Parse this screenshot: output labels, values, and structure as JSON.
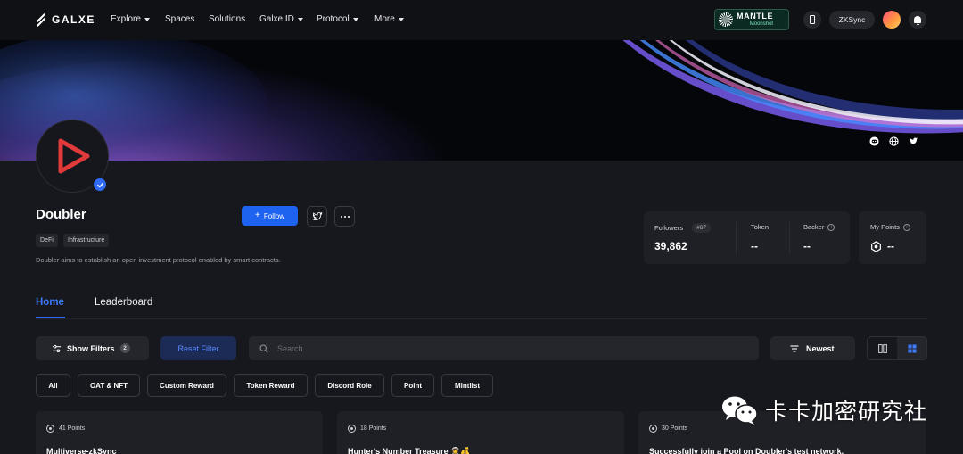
{
  "nav": {
    "logo_text": "GALXE",
    "items": [
      {
        "label": "Explore",
        "dropdown": true
      },
      {
        "label": "Spaces",
        "dropdown": false
      },
      {
        "label": "Solutions",
        "dropdown": false
      },
      {
        "label": "Galxe ID",
        "dropdown": true
      },
      {
        "label": "Protocol",
        "dropdown": true
      },
      {
        "label": "More",
        "dropdown": true
      }
    ],
    "promo_title": "MANTLE",
    "promo_subtitle": "Moonshot",
    "chain_label": "ZKSync"
  },
  "banner": {
    "links": [
      "discord-icon",
      "globe-icon",
      "twitter-icon"
    ]
  },
  "profile": {
    "name": "Doubler",
    "tags": [
      "DeFi",
      "Infrastructure"
    ],
    "description": "Doubler aims to establish an open investment protocol enabled by smart contracts.",
    "follow_label": "Follow",
    "verified": true
  },
  "stats": {
    "followers_label": "Followers",
    "followers_rank": "#67",
    "followers_value": "39,862",
    "token_label": "Token",
    "token_value": "--",
    "backer_label": "Backer",
    "backer_value": "--",
    "points_label": "My Points",
    "points_value": "--"
  },
  "tabs": [
    {
      "label": "Home",
      "active": true
    },
    {
      "label": "Leaderboard",
      "active": false
    }
  ],
  "filters": {
    "show_filters_label": "Show Filters",
    "filter_count": "2",
    "reset_label": "Reset Filter",
    "search_placeholder": "Search",
    "sort_label": "Newest",
    "view_mode": "grid"
  },
  "chips": [
    "All",
    "OAT & NFT",
    "Custom Reward",
    "Token Reward",
    "Discord Role",
    "Point",
    "Mintlist"
  ],
  "cards": [
    {
      "points": "41 Points",
      "title": "Multiverse-zkSync"
    },
    {
      "points": "18 Points",
      "title": "Hunter's Number Treasure 🧑‍🚀💰"
    },
    {
      "points": "30 Points",
      "title": "Successfully join a Pool on Doubler's test network."
    }
  ],
  "watermark": {
    "text": "卡卡加密研究社"
  },
  "colors": {
    "accent": "#2f6bf5",
    "background": "#17181d",
    "card": "#1f2026"
  }
}
